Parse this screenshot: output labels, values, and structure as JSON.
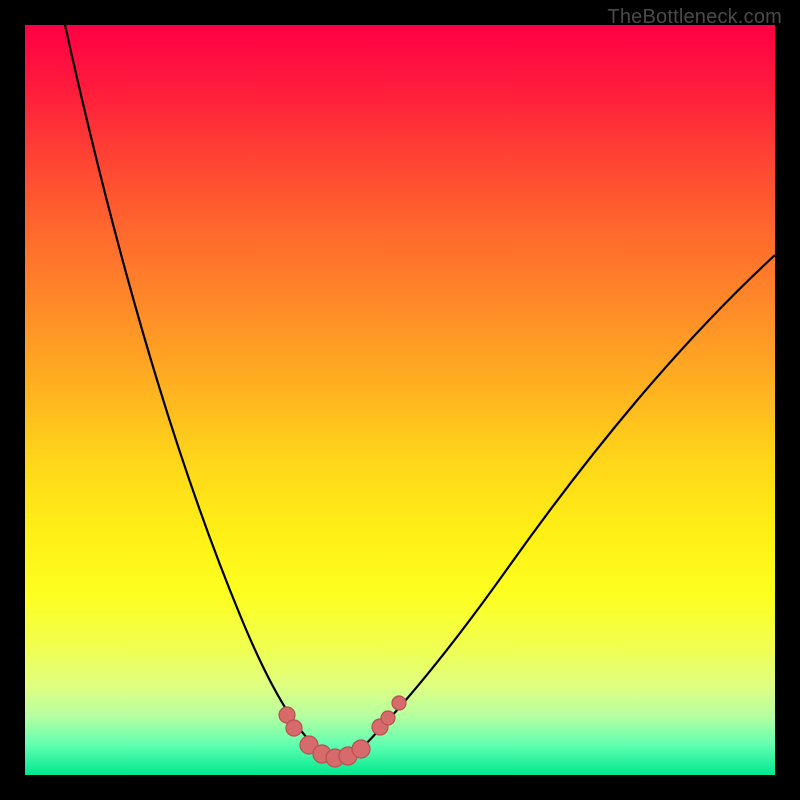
{
  "watermark": "TheBottleneck.com",
  "chart_data": {
    "type": "line",
    "title": "",
    "xlabel": "",
    "ylabel": "",
    "xlim": [
      0,
      100
    ],
    "ylim": [
      0,
      100
    ],
    "background_gradient": {
      "top": "#ff0044",
      "middle": "#ffe018",
      "bottom": "#00e890"
    },
    "series": [
      {
        "name": "bottleneck-curve",
        "x": [
          5,
          12,
          20,
          28,
          34,
          38,
          40,
          42,
          44,
          48,
          55,
          65,
          78,
          92,
          100
        ],
        "y": [
          100,
          70,
          45,
          25,
          10,
          4,
          2,
          1.5,
          3,
          8,
          18,
          35,
          52,
          64,
          70
        ]
      }
    ],
    "markers": {
      "name": "highlighted-points",
      "color": "#d76a6a",
      "x": [
        35,
        36,
        38,
        39.5,
        41,
        43,
        45,
        47,
        48,
        50
      ],
      "y": [
        8,
        6.5,
        4,
        2.8,
        2.2,
        2.5,
        3.5,
        6.3,
        7.5,
        9.5
      ]
    },
    "note": "Axes are unlabeled in the source image; x/y values are estimated on a 0–100 normalized scale from pixel positions."
  }
}
